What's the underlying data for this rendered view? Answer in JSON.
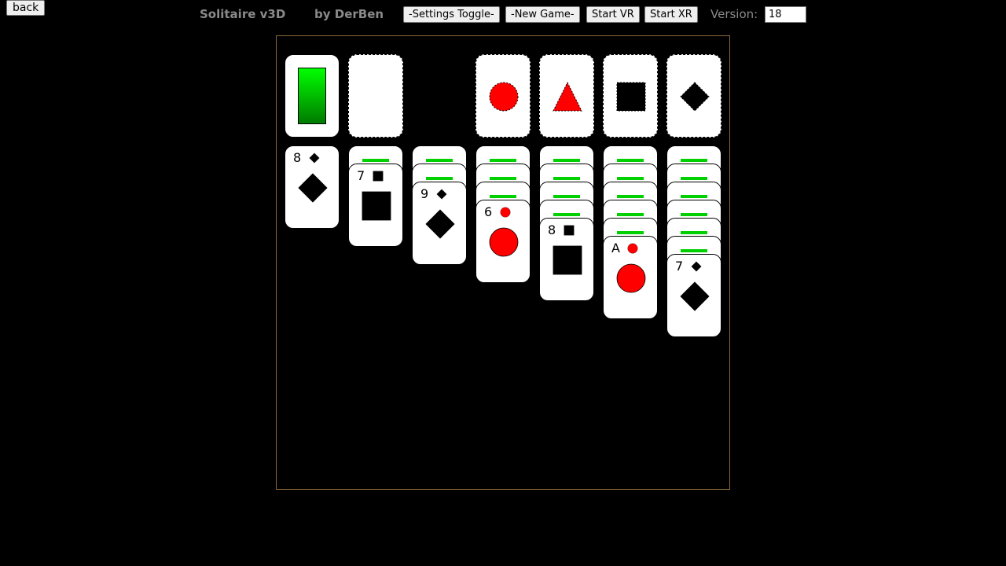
{
  "header": {
    "back_label": "back",
    "title": "Solitaire v3D",
    "author": "by DerBen",
    "settings_label": "-Settings Toggle-",
    "newgame_label": "-New Game-",
    "vr_label": "Start VR",
    "xr_label": "Start XR",
    "version_label": "Version:",
    "version_value": "18"
  },
  "colors": {
    "green": "#00ff00",
    "red": "#ff0000",
    "black": "#000000",
    "board_border": "#8b6a3a"
  },
  "stock": {
    "state": "face-down deck"
  },
  "foundations": [
    {
      "suit": "circle",
      "color": "#ff0000"
    },
    {
      "suit": "triangle",
      "color": "#ff0000"
    },
    {
      "suit": "square",
      "color": "#000000"
    },
    {
      "suit": "diamond",
      "color": "#000000"
    }
  ],
  "tableau": [
    {
      "facedown": 0,
      "top": {
        "rank": "8",
        "suit": "diamond",
        "color": "#000000"
      }
    },
    {
      "facedown": 1,
      "top": {
        "rank": "7",
        "suit": "square",
        "color": "#000000"
      }
    },
    {
      "facedown": 2,
      "top": {
        "rank": "9",
        "suit": "diamond",
        "color": "#000000"
      }
    },
    {
      "facedown": 3,
      "top": {
        "rank": "6",
        "suit": "circle",
        "color": "#ff0000"
      }
    },
    {
      "facedown": 4,
      "top": {
        "rank": "8",
        "suit": "square",
        "color": "#000000"
      }
    },
    {
      "facedown": 5,
      "top": {
        "rank": "A",
        "suit": "circle",
        "color": "#ff0000"
      }
    },
    {
      "facedown": 6,
      "top": {
        "rank": "7",
        "suit": "diamond",
        "color": "#000000"
      }
    }
  ]
}
